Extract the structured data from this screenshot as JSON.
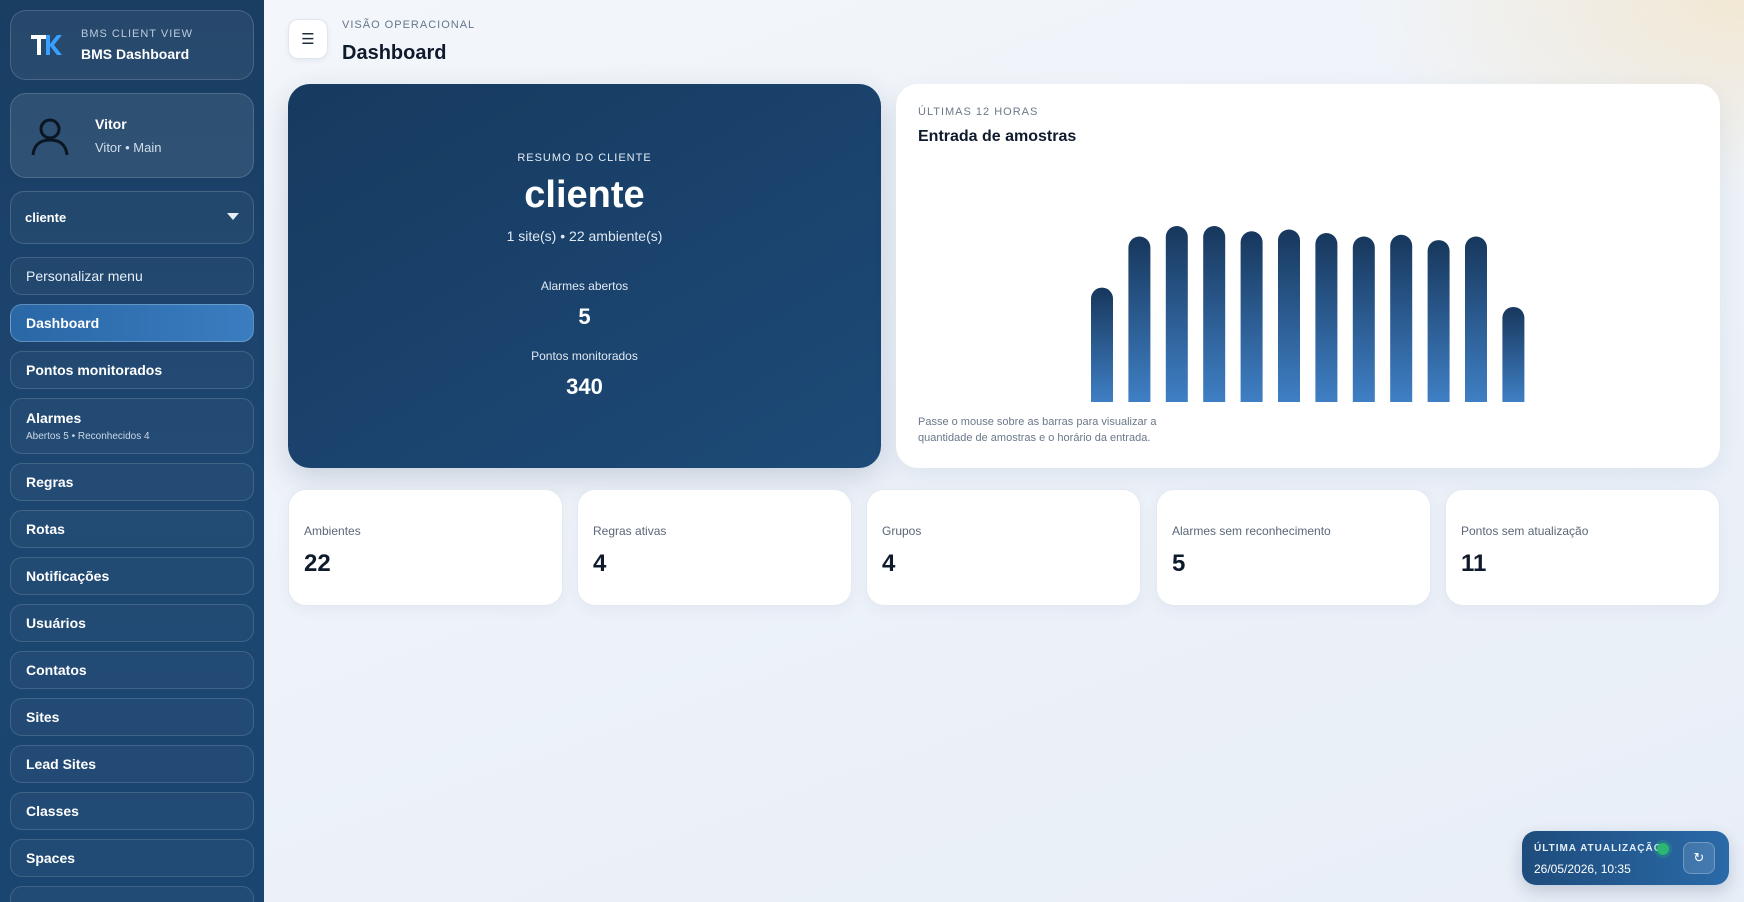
{
  "brand": {
    "kicker": "BMS CLIENT VIEW",
    "title": "BMS Dashboard",
    "logo_text": "TK"
  },
  "user": {
    "name": "Vitor",
    "sub": "Vitor • Main"
  },
  "client_select": {
    "value": "cliente"
  },
  "nav": {
    "customize": "Personalizar menu",
    "items": [
      {
        "label": "Dashboard",
        "active": true
      },
      {
        "label": "Pontos monitorados"
      },
      {
        "label": "Alarmes",
        "sub": "Abertos 5 • Reconhecidos 4"
      },
      {
        "label": "Regras"
      },
      {
        "label": "Rotas"
      },
      {
        "label": "Notificações"
      },
      {
        "label": "Usuários"
      },
      {
        "label": "Contatos"
      },
      {
        "label": "Sites"
      },
      {
        "label": "Lead Sites"
      },
      {
        "label": "Classes"
      },
      {
        "label": "Spaces"
      }
    ]
  },
  "header": {
    "kicker": "VISÃO OPERACIONAL",
    "title": "Dashboard",
    "menu_icon": "☰"
  },
  "summary": {
    "kicker": "RESUMO DO CLIENTE",
    "name": "cliente",
    "meta": "1 site(s) • 22 ambiente(s)",
    "alarms_label": "Alarmes abertos",
    "alarms_value": "5",
    "points_label": "Pontos monitorados",
    "points_value": "340"
  },
  "chart_card": {
    "kicker": "ÚLTIMAS 12 HORAS",
    "title": "Entrada de amostras",
    "hint": "Passe o mouse sobre as barras para visualizar a quantidade de amostras e o horário da entrada."
  },
  "chart_data": {
    "type": "bar",
    "categories": [
      "",
      "",
      "",
      "",
      "",
      "",
      "",
      "",
      "",
      "",
      "",
      ""
    ],
    "values": [
      0.65,
      0.94,
      1.0,
      1.0,
      0.97,
      0.98,
      0.96,
      0.94,
      0.95,
      0.92,
      0.94,
      0.54
    ],
    "ylim": [
      0,
      1
    ],
    "grid": false,
    "colors": {
      "top": "#17375c",
      "bottom": "#3f7fc4"
    }
  },
  "stats": [
    {
      "label": "Ambientes",
      "value": "22"
    },
    {
      "label": "Regras ativas",
      "value": "4"
    },
    {
      "label": "Grupos",
      "value": "4"
    },
    {
      "label": "Alarmes sem reconhecimento",
      "value": "5"
    },
    {
      "label": "Pontos sem atualização",
      "value": "11"
    }
  ],
  "update": {
    "label": "ÚLTIMA ATUALIZAÇÃO",
    "time": "26/05/2026, 10:35",
    "status_color": "#2bb673"
  }
}
